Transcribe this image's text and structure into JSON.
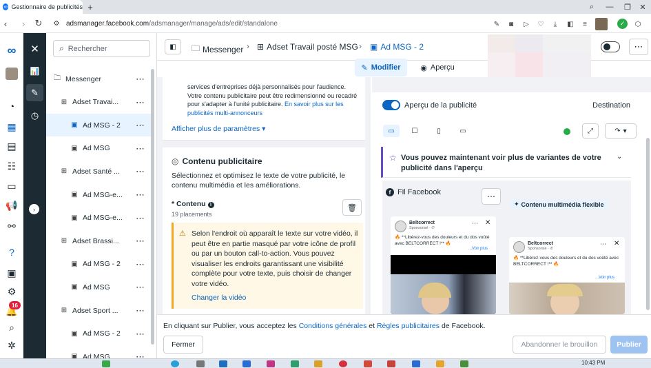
{
  "browser": {
    "tab_title": "Gestionnaire de publicités",
    "url_host": "adsmanager.facebook.com",
    "url_path": "/adsmanager/manage/ads/edit/standalone"
  },
  "search": {
    "placeholder": "Rechercher"
  },
  "tree": {
    "items": [
      {
        "label": "Messenger",
        "type": "campaign"
      },
      {
        "label": "Adset Travai...",
        "type": "adset"
      },
      {
        "label": "Ad MSG - 2",
        "type": "ad",
        "selected": true
      },
      {
        "label": "Ad MSG",
        "type": "ad"
      },
      {
        "label": "Adset Santé ...",
        "type": "adset"
      },
      {
        "label": "Ad MSG-e...",
        "type": "ad"
      },
      {
        "label": "Ad MSG-e...",
        "type": "ad"
      },
      {
        "label": "Adset Brassi...",
        "type": "adset"
      },
      {
        "label": "Ad MSG - 2",
        "type": "ad"
      },
      {
        "label": "Ad MSG",
        "type": "ad"
      },
      {
        "label": "Adset Sport ...",
        "type": "adset"
      },
      {
        "label": "Ad MSG - 2",
        "type": "ad"
      },
      {
        "label": "Ad MSG",
        "type": "ad"
      }
    ]
  },
  "notifications_badge": "16",
  "breadcrumb": {
    "campaign": "Messenger",
    "adset": "Adset Travail posté MSG",
    "ad": "Ad MSG - 2"
  },
  "mode": {
    "edit": "Modifier",
    "preview": "Aperçu"
  },
  "editor": {
    "intro_text": "services d'entreprises déjà personnalisés pour l'audience. Votre contenu publicitaire peut être redimensionné ou recadré pour s'adapter à l'unité publicitaire.",
    "intro_link": "En savoir plus sur les publicités multi-annonceurs",
    "more_params": "Afficher plus de paramètres",
    "content_title": "Contenu publicitaire",
    "content_desc": "Sélectionnez et optimisez le texte de votre publicité, le contenu multimédia et les améliorations.",
    "content_label": "* Contenu",
    "placements": "19 placements",
    "warning": "Selon l'endroit où apparaît le texte sur votre vidéo, il peut être en partie masqué par votre icône de profil ou par un bouton call-to-action. Vous pouvez visualiser les endroits garantissant une visibilité complète pour votre texte, puis choisir de changer votre vidéo.",
    "change_video": "Changer la vidéo"
  },
  "preview": {
    "toggle_label": "Aperçu de la publicité",
    "destination": "Destination",
    "variants_banner": "Vous pouvez maintenant voir plus de variantes de votre publicité dans l'aperçu",
    "placement": "Fil Facebook",
    "flex_badge": "Contenu multimédia flexible",
    "ads": [
      {
        "page": "Beltcorrect",
        "sponsored": "Sponsorisé · ✆",
        "text": "🔥 **Libérez-vous des douleurs et du dos voûté avec BELTCORRECT !** 🔥",
        "more": "...Voir plus"
      },
      {
        "page": "Beltcorrect",
        "sponsored": "Sponsorisé · ✆",
        "text": "🔥 **Libérez-vous des douleurs et du dos voûté avec BELTCORRECT !** 🔥",
        "more": "...Voir plus"
      }
    ]
  },
  "footer": {
    "consent_pre": "En cliquant sur Publier, vous acceptez les",
    "consent_link1": "Conditions générales",
    "consent_and": "et",
    "consent_link2": "Règles publicitaires",
    "consent_post": "de Facebook.",
    "close": "Fermer",
    "discard": "Abandonner le brouillon",
    "publish": "Publier"
  },
  "taskbar": {
    "time": "10:43 PM"
  },
  "colors": {
    "accent": "#0a66c2",
    "dark_rail": "#1c2b33",
    "warning_border": "#f5a623",
    "badge": "#e41e3f"
  }
}
